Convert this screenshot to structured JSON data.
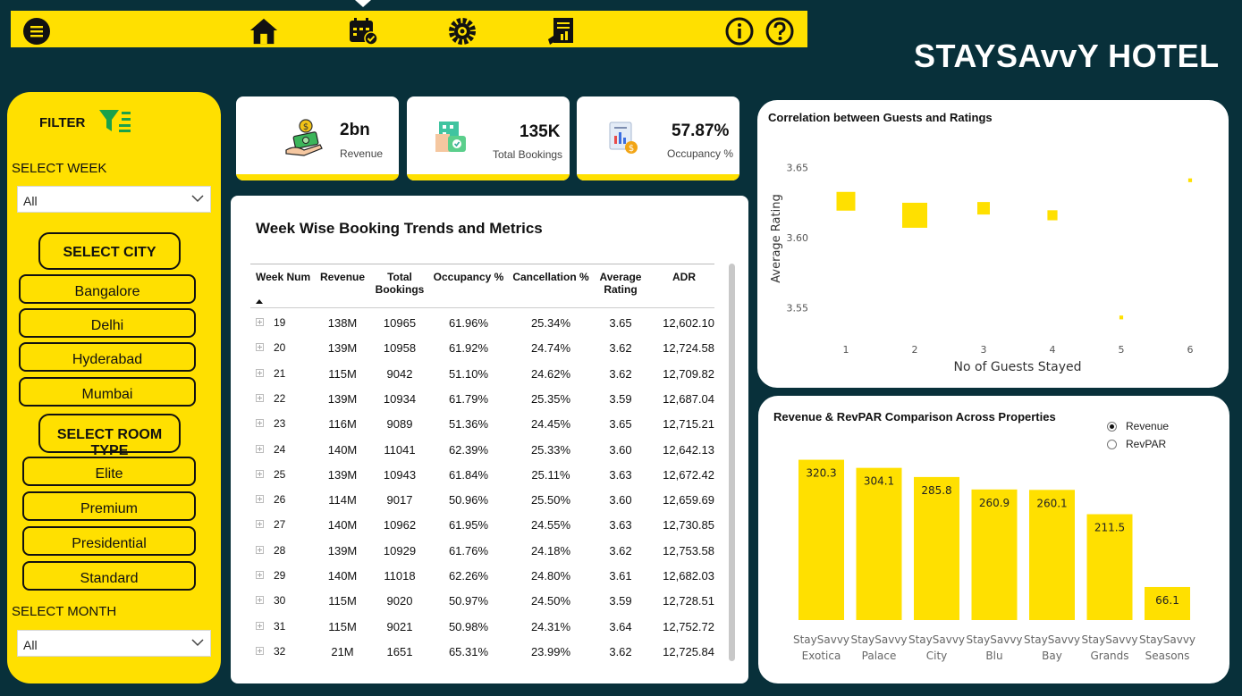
{
  "app": {
    "brand": "STAYSAvvY HOTEL",
    "colors": {
      "accent": "#ffe000",
      "background": "#08303a",
      "card": "#ffffff"
    }
  },
  "nav": {
    "icons": [
      "menu-icon",
      "home-icon",
      "calendar-check-icon",
      "settings-gear-icon",
      "report-icon",
      "info-icon",
      "help-icon"
    ]
  },
  "filter": {
    "title": "FILTER",
    "select_week_label": "SELECT WEEK",
    "week_value": "All",
    "select_city_label": "SELECT CITY",
    "cities": [
      "Bangalore",
      "Delhi",
      "Hyderabad",
      "Mumbai"
    ],
    "select_room_label": "SELECT ROOM TYPE",
    "rooms": [
      "Elite",
      "Premium",
      "Presidential",
      "Standard"
    ],
    "select_month_label": "SELECT MONTH",
    "month_value": "All"
  },
  "kpis": [
    {
      "value": "2bn",
      "label": "Revenue",
      "icon": "money-hand-icon"
    },
    {
      "value": "135K",
      "label": "Total Bookings",
      "icon": "hotel-booking-icon"
    },
    {
      "value": "57.87%",
      "label": "Occupancy %",
      "icon": "occupancy-chart-icon"
    }
  ],
  "table": {
    "title": "Week Wise Booking Trends and Metrics",
    "columns": [
      "Week Num",
      "Revenue",
      "Total Bookings",
      "Occupancy %",
      "Cancellation %",
      "Average Rating",
      "ADR"
    ],
    "rows": [
      [
        "19",
        "138M",
        "10965",
        "61.96%",
        "25.34%",
        "3.65",
        "12,602.10"
      ],
      [
        "20",
        "139M",
        "10958",
        "61.92%",
        "24.74%",
        "3.62",
        "12,724.58"
      ],
      [
        "21",
        "115M",
        "9042",
        "51.10%",
        "24.62%",
        "3.62",
        "12,709.82"
      ],
      [
        "22",
        "139M",
        "10934",
        "61.79%",
        "25.35%",
        "3.59",
        "12,687.04"
      ],
      [
        "23",
        "116M",
        "9089",
        "51.36%",
        "24.45%",
        "3.65",
        "12,715.21"
      ],
      [
        "24",
        "140M",
        "11041",
        "62.39%",
        "25.33%",
        "3.60",
        "12,642.13"
      ],
      [
        "25",
        "139M",
        "10943",
        "61.84%",
        "25.11%",
        "3.63",
        "12,672.42"
      ],
      [
        "26",
        "114M",
        "9017",
        "50.96%",
        "25.50%",
        "3.60",
        "12,659.69"
      ],
      [
        "27",
        "140M",
        "10962",
        "61.95%",
        "24.55%",
        "3.63",
        "12,730.85"
      ],
      [
        "28",
        "139M",
        "10929",
        "61.76%",
        "24.18%",
        "3.62",
        "12,753.58"
      ],
      [
        "29",
        "140M",
        "11018",
        "62.26%",
        "24.80%",
        "3.61",
        "12,682.03"
      ],
      [
        "30",
        "115M",
        "9020",
        "50.97%",
        "24.50%",
        "3.59",
        "12,728.51"
      ],
      [
        "31",
        "115M",
        "9021",
        "50.98%",
        "24.31%",
        "3.64",
        "12,752.72"
      ],
      [
        "32",
        "21M",
        "1651",
        "65.31%",
        "23.99%",
        "3.62",
        "12,725.84"
      ]
    ]
  },
  "chart_data": [
    {
      "type": "scatter",
      "title": "Correlation between Guests and Ratings",
      "xlabel": "No of Guests Stayed",
      "ylabel": "Average Rating",
      "x_ticks": [
        "1",
        "2",
        "3",
        "4",
        "5",
        "6"
      ],
      "y_ticks": [
        "3.55",
        "3.60",
        "3.65"
      ],
      "ylim": [
        3.54,
        3.66
      ],
      "marker_color": "#ffe000",
      "points": [
        {
          "x": 1,
          "y": 3.626,
          "size": 3
        },
        {
          "x": 2,
          "y": 3.616,
          "size": 4
        },
        {
          "x": 3,
          "y": 3.621,
          "size": 2
        },
        {
          "x": 4,
          "y": 3.616,
          "size": 1.6
        },
        {
          "x": 5,
          "y": 3.543,
          "size": 0.6
        },
        {
          "x": 6,
          "y": 3.641,
          "size": 0.6
        }
      ]
    },
    {
      "type": "bar",
      "title": "Revenue & RevPAR Comparison Across Properties",
      "legend": [
        {
          "label": "Revenue",
          "selected": true
        },
        {
          "label": "RevPAR",
          "selected": false
        }
      ],
      "categories": [
        [
          "StaySavvy",
          "Exotica"
        ],
        [
          "StaySavvy",
          "Palace"
        ],
        [
          "StaySavvy",
          "City"
        ],
        [
          "StaySavvy",
          "Blu"
        ],
        [
          "StaySavvy",
          "Bay"
        ],
        [
          "StaySavvy",
          "Grands"
        ],
        [
          "StaySavvy",
          "Seasons"
        ]
      ],
      "values": [
        320.3,
        304.1,
        285.8,
        260.9,
        260.1,
        211.5,
        66.1
      ],
      "labels": [
        "320.3",
        "304.1",
        "285.8",
        "260.9",
        "260.1",
        "211.5",
        "66.1"
      ],
      "ylim": [
        0,
        340
      ],
      "bar_color": "#ffe000"
    }
  ]
}
